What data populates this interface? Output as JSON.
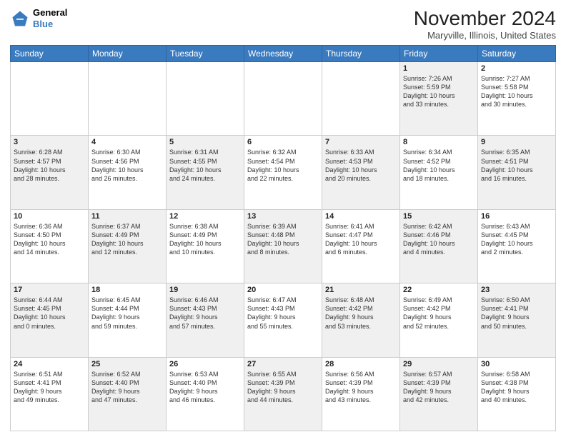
{
  "header": {
    "logo_line1": "General",
    "logo_line2": "Blue",
    "month": "November 2024",
    "location": "Maryville, Illinois, United States"
  },
  "weekdays": [
    "Sunday",
    "Monday",
    "Tuesday",
    "Wednesday",
    "Thursday",
    "Friday",
    "Saturday"
  ],
  "weeks": [
    [
      {
        "day": "",
        "info": "",
        "shaded": false
      },
      {
        "day": "",
        "info": "",
        "shaded": false
      },
      {
        "day": "",
        "info": "",
        "shaded": false
      },
      {
        "day": "",
        "info": "",
        "shaded": false
      },
      {
        "day": "",
        "info": "",
        "shaded": false
      },
      {
        "day": "1",
        "info": "Sunrise: 7:26 AM\nSunset: 5:59 PM\nDaylight: 10 hours\nand 33 minutes.",
        "shaded": true
      },
      {
        "day": "2",
        "info": "Sunrise: 7:27 AM\nSunset: 5:58 PM\nDaylight: 10 hours\nand 30 minutes.",
        "shaded": false
      }
    ],
    [
      {
        "day": "3",
        "info": "Sunrise: 6:28 AM\nSunset: 4:57 PM\nDaylight: 10 hours\nand 28 minutes.",
        "shaded": true
      },
      {
        "day": "4",
        "info": "Sunrise: 6:30 AM\nSunset: 4:56 PM\nDaylight: 10 hours\nand 26 minutes.",
        "shaded": false
      },
      {
        "day": "5",
        "info": "Sunrise: 6:31 AM\nSunset: 4:55 PM\nDaylight: 10 hours\nand 24 minutes.",
        "shaded": true
      },
      {
        "day": "6",
        "info": "Sunrise: 6:32 AM\nSunset: 4:54 PM\nDaylight: 10 hours\nand 22 minutes.",
        "shaded": false
      },
      {
        "day": "7",
        "info": "Sunrise: 6:33 AM\nSunset: 4:53 PM\nDaylight: 10 hours\nand 20 minutes.",
        "shaded": true
      },
      {
        "day": "8",
        "info": "Sunrise: 6:34 AM\nSunset: 4:52 PM\nDaylight: 10 hours\nand 18 minutes.",
        "shaded": false
      },
      {
        "day": "9",
        "info": "Sunrise: 6:35 AM\nSunset: 4:51 PM\nDaylight: 10 hours\nand 16 minutes.",
        "shaded": true
      }
    ],
    [
      {
        "day": "10",
        "info": "Sunrise: 6:36 AM\nSunset: 4:50 PM\nDaylight: 10 hours\nand 14 minutes.",
        "shaded": false
      },
      {
        "day": "11",
        "info": "Sunrise: 6:37 AM\nSunset: 4:49 PM\nDaylight: 10 hours\nand 12 minutes.",
        "shaded": true
      },
      {
        "day": "12",
        "info": "Sunrise: 6:38 AM\nSunset: 4:49 PM\nDaylight: 10 hours\nand 10 minutes.",
        "shaded": false
      },
      {
        "day": "13",
        "info": "Sunrise: 6:39 AM\nSunset: 4:48 PM\nDaylight: 10 hours\nand 8 minutes.",
        "shaded": true
      },
      {
        "day": "14",
        "info": "Sunrise: 6:41 AM\nSunset: 4:47 PM\nDaylight: 10 hours\nand 6 minutes.",
        "shaded": false
      },
      {
        "day": "15",
        "info": "Sunrise: 6:42 AM\nSunset: 4:46 PM\nDaylight: 10 hours\nand 4 minutes.",
        "shaded": true
      },
      {
        "day": "16",
        "info": "Sunrise: 6:43 AM\nSunset: 4:45 PM\nDaylight: 10 hours\nand 2 minutes.",
        "shaded": false
      }
    ],
    [
      {
        "day": "17",
        "info": "Sunrise: 6:44 AM\nSunset: 4:45 PM\nDaylight: 10 hours\nand 0 minutes.",
        "shaded": true
      },
      {
        "day": "18",
        "info": "Sunrise: 6:45 AM\nSunset: 4:44 PM\nDaylight: 9 hours\nand 59 minutes.",
        "shaded": false
      },
      {
        "day": "19",
        "info": "Sunrise: 6:46 AM\nSunset: 4:43 PM\nDaylight: 9 hours\nand 57 minutes.",
        "shaded": true
      },
      {
        "day": "20",
        "info": "Sunrise: 6:47 AM\nSunset: 4:43 PM\nDaylight: 9 hours\nand 55 minutes.",
        "shaded": false
      },
      {
        "day": "21",
        "info": "Sunrise: 6:48 AM\nSunset: 4:42 PM\nDaylight: 9 hours\nand 53 minutes.",
        "shaded": true
      },
      {
        "day": "22",
        "info": "Sunrise: 6:49 AM\nSunset: 4:42 PM\nDaylight: 9 hours\nand 52 minutes.",
        "shaded": false
      },
      {
        "day": "23",
        "info": "Sunrise: 6:50 AM\nSunset: 4:41 PM\nDaylight: 9 hours\nand 50 minutes.",
        "shaded": true
      }
    ],
    [
      {
        "day": "24",
        "info": "Sunrise: 6:51 AM\nSunset: 4:41 PM\nDaylight: 9 hours\nand 49 minutes.",
        "shaded": false
      },
      {
        "day": "25",
        "info": "Sunrise: 6:52 AM\nSunset: 4:40 PM\nDaylight: 9 hours\nand 47 minutes.",
        "shaded": true
      },
      {
        "day": "26",
        "info": "Sunrise: 6:53 AM\nSunset: 4:40 PM\nDaylight: 9 hours\nand 46 minutes.",
        "shaded": false
      },
      {
        "day": "27",
        "info": "Sunrise: 6:55 AM\nSunset: 4:39 PM\nDaylight: 9 hours\nand 44 minutes.",
        "shaded": true
      },
      {
        "day": "28",
        "info": "Sunrise: 6:56 AM\nSunset: 4:39 PM\nDaylight: 9 hours\nand 43 minutes.",
        "shaded": false
      },
      {
        "day": "29",
        "info": "Sunrise: 6:57 AM\nSunset: 4:39 PM\nDaylight: 9 hours\nand 42 minutes.",
        "shaded": true
      },
      {
        "day": "30",
        "info": "Sunrise: 6:58 AM\nSunset: 4:38 PM\nDaylight: 9 hours\nand 40 minutes.",
        "shaded": false
      }
    ]
  ]
}
